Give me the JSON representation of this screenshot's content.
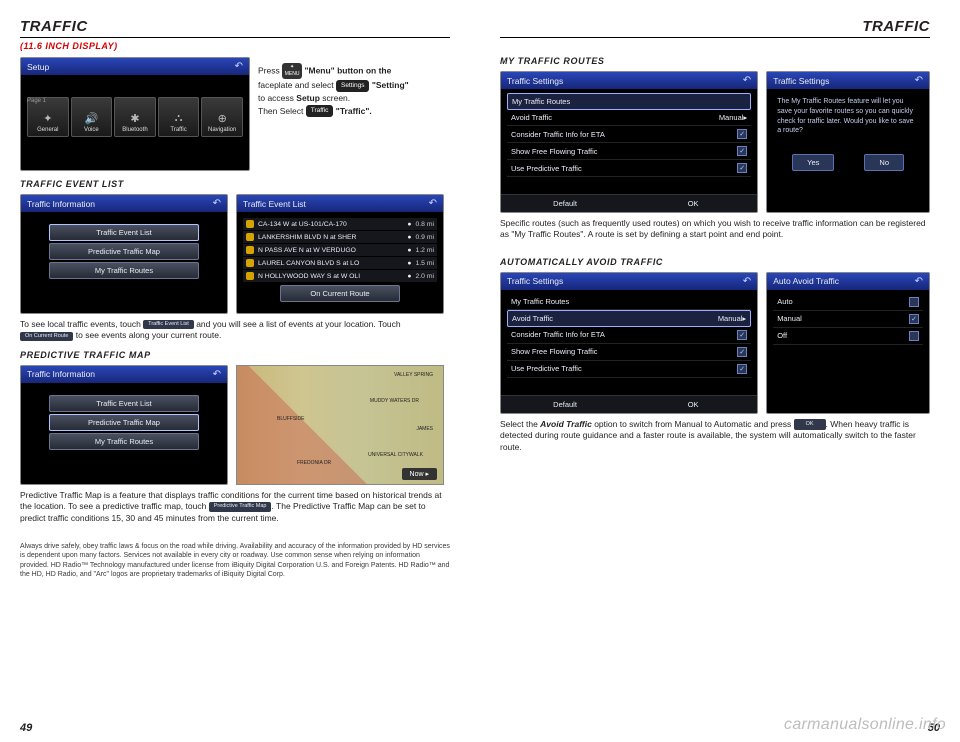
{
  "header": {
    "left": "TRAFFIC",
    "right": "TRAFFIC",
    "sub": "(11.6 INCH DISPLAY)"
  },
  "setup": {
    "title": "Setup",
    "page": "Page 1",
    "tiles": [
      {
        "icon": "✦",
        "label": "General"
      },
      {
        "icon": "🔊",
        "label": "Voice"
      },
      {
        "icon": "✱",
        "label": "Bluetooth"
      },
      {
        "icon": "⛬",
        "label": "Traffic"
      },
      {
        "icon": "⊕",
        "label": "Navigation"
      }
    ]
  },
  "intro": {
    "l1a": "Press ",
    "menu": "MENU",
    "l1b": " \"Menu\" button on the",
    "l2a": "faceplate and select ",
    "settings": "Settings",
    "l2b": " \"Setting\"",
    "l3": "to access Setup screen.",
    "l4a": "Then Select ",
    "traffic": "Traffic",
    "l4b": " \"Traffic\"."
  },
  "sections": {
    "eventList": "TRAFFIC EVENT LIST",
    "predictive": "PREDICTIVE TRAFFIC MAP",
    "myRoutes": "MY TRAFFIC ROUTES",
    "autoAvoid": "AUTOMATICALLY AVOID TRAFFIC"
  },
  "trafficInfo": {
    "title": "Traffic Information",
    "items": [
      "Traffic Event List",
      "Predictive Traffic Map",
      "My Traffic Routes"
    ]
  },
  "eventList": {
    "title": "Traffic Event List",
    "footer": "On Current Route",
    "rows": [
      {
        "txt": "CA-134 W at US-101/CA-170",
        "dist": "0.8 mi"
      },
      {
        "txt": "LANKERSHIM BLVD N at SHER",
        "dist": "0.9 mi"
      },
      {
        "txt": "N PASS AVE N at W VERDUGO",
        "dist": "1.2 mi"
      },
      {
        "txt": "LAUREL CANYON BLVD S at LO",
        "dist": "1.5 mi"
      },
      {
        "txt": "N HOLLYWOOD WAY S at W OLI",
        "dist": "2.0 mi"
      }
    ]
  },
  "para1": {
    "a": "To see local traffic events, touch ",
    "pill1": "Traffic Event List",
    "b": " and you will see a list of events at your location.  Touch ",
    "pill2": "On Current Route",
    "c": " to see events along your current route."
  },
  "map": {
    "labels": [
      "VALLEY SPRING",
      "MUDDY WATERS DR",
      "BLUFFSIDE",
      "UNIVERSAL CITYWALK",
      "FREDONIA DR",
      "JAMES"
    ],
    "now": "Now   ▸"
  },
  "para2": {
    "a": "Predictive Traffic Map is a feature that displays traffic conditions for the current time based on historical trends at the location.  To see a predictive traffic map,  touch ",
    "pill": "Predictive Traffic Map",
    "b": ".  The Predictive Traffic Map can be set to predict traffic conditions 15, 30 and 45 minutes from the current time."
  },
  "trafficSettings": {
    "title": "Traffic Settings",
    "rows": [
      {
        "label": "My Traffic Routes",
        "val": "",
        "hl": true
      },
      {
        "label": "Avoid Traffic",
        "val": "Manual▸"
      },
      {
        "label": "Consider Traffic Info for ETA",
        "chk": true
      },
      {
        "label": "Show Free Flowing Traffic",
        "chk": true
      },
      {
        "label": "Use Predictive Traffic",
        "chk": true
      }
    ],
    "footL": "Default",
    "footR": "OK"
  },
  "trafficSettings2": {
    "rows": [
      {
        "label": "My Traffic Routes",
        "val": ""
      },
      {
        "label": "Avoid Traffic",
        "val": "Manual▸",
        "hl": true
      },
      {
        "label": "Consider Traffic Info for ETA",
        "chk": true
      },
      {
        "label": "Show Free Flowing Traffic",
        "chk": true
      },
      {
        "label": "Use Predictive Traffic",
        "chk": true
      }
    ]
  },
  "prompt": {
    "title": "Traffic Settings",
    "text": "The My Traffic Routes feature will let you save your favorite routes so you can quickly check for traffic later. Would you like to save a route?",
    "yes": "Yes",
    "no": "No"
  },
  "paraRoutes": "Specific routes (such as frequently used routes) on which you wish to receive traffic information can be registered as \"My Traffic Routes\". A route is set by defining a start point and end point.",
  "autoAvoid": {
    "title": "Auto Avoid Traffic",
    "rows": [
      {
        "label": "Auto",
        "chk": false
      },
      {
        "label": "Manual",
        "chk": true
      },
      {
        "label": "Off",
        "chk": false
      }
    ]
  },
  "paraAvoid": {
    "a": "Select the ",
    "em": "Avoid Traffic",
    "b": " option to switch from Manual to Automatic and press ",
    "pill": "OK",
    "c": ".  When heavy traffic is detected during route guidance and a faster route is available, the system will automatically switch to the faster route."
  },
  "footnote": "Always drive safely, obey traffic laws & focus on the road while driving. Availability and accuracy of the information provided by HD services is dependent upon many factors. Services not available in every city or roadway. Use common sense when relying on information provided.  HD Radio™ Technology manufactured under license from iBiquity Digital Corporation U.S. and Foreign Patents. HD Radio™ and the HD, HD Radio, and \"Arc\" logos are proprietary trademarks of iBiquity Digital Corp.",
  "pagenum": {
    "left": "49",
    "right": "50"
  },
  "watermark": "carmanualsonline.info"
}
